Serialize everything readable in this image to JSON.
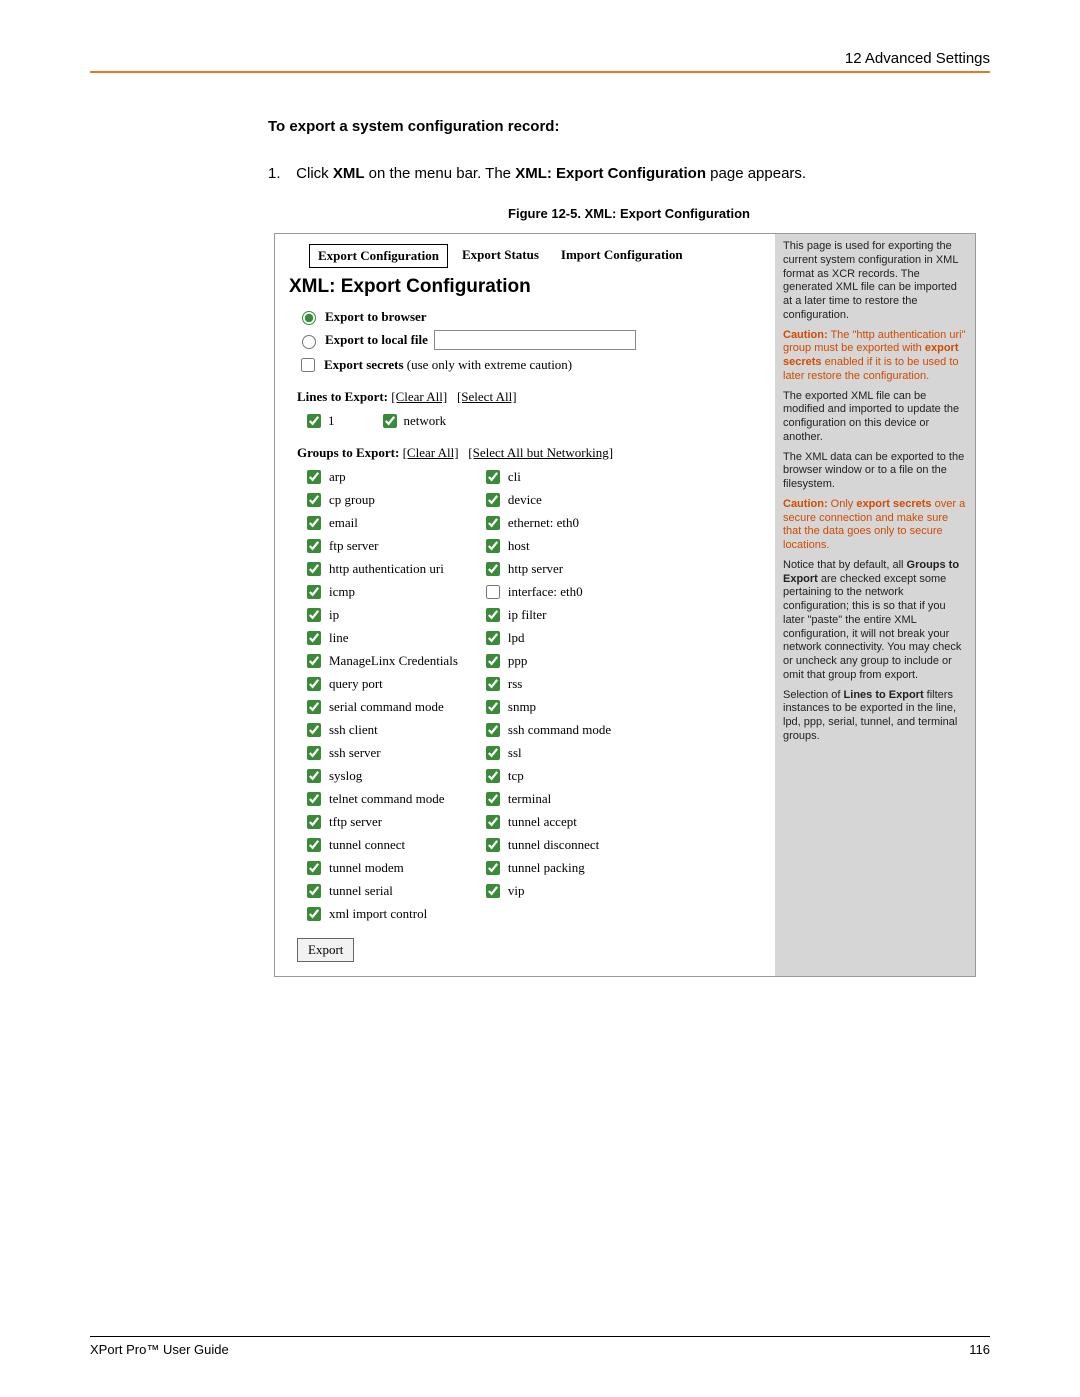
{
  "header": {
    "title": "12 Advanced Settings"
  },
  "body": {
    "heading": "To export a system configuration record:",
    "step_num": "1.",
    "step_a": "Click ",
    "step_b": "XML",
    "step_c": " on the menu bar. The ",
    "step_d": "XML: Export Configuration",
    "step_e": " page appears.",
    "fig_caption": "Figure 12-5. XML: Export Configuration"
  },
  "shot": {
    "tabs": {
      "t1": "Export Configuration",
      "t2": "Export Status",
      "t3": "Import Configuration"
    },
    "title": "XML: Export Configuration",
    "radio1": "Export to browser",
    "radio2": "Export to local file",
    "secrets_lbl": "Export secrets",
    "secrets_paren": " (use only with extreme caution)",
    "lines_label": "Lines to Export:  ",
    "clear_all": "[Clear All]",
    "select_all": "[Select All]",
    "line_items": {
      "a": "1",
      "b": "network"
    },
    "groups_label": "Groups to Export:  ",
    "sel_not_net": "[Select All but Networking]",
    "groups_left": [
      "arp",
      "cp group",
      "email",
      "ftp server",
      "http authentication uri",
      "icmp",
      "ip",
      "line",
      "ManageLinx Credentials",
      "query port",
      "serial command mode",
      "ssh client",
      "ssh server",
      "syslog",
      "telnet command mode",
      "tftp server",
      "tunnel connect",
      "tunnel modem",
      "tunnel serial",
      "xml import control"
    ],
    "groups_right": [
      {
        "label": "cli",
        "checked": true
      },
      {
        "label": "device",
        "checked": true
      },
      {
        "label": "ethernet: eth0",
        "checked": true
      },
      {
        "label": "host",
        "checked": true
      },
      {
        "label": "http server",
        "checked": true
      },
      {
        "label": "interface: eth0",
        "checked": false
      },
      {
        "label": "ip filter",
        "checked": true
      },
      {
        "label": "lpd",
        "checked": true
      },
      {
        "label": "ppp",
        "checked": true
      },
      {
        "label": "rss",
        "checked": true
      },
      {
        "label": "snmp",
        "checked": true
      },
      {
        "label": "ssh command mode",
        "checked": true
      },
      {
        "label": "ssl",
        "checked": true
      },
      {
        "label": "tcp",
        "checked": true
      },
      {
        "label": "terminal",
        "checked": true
      },
      {
        "label": "tunnel accept",
        "checked": true
      },
      {
        "label": "tunnel disconnect",
        "checked": true
      },
      {
        "label": "tunnel packing",
        "checked": true
      },
      {
        "label": "vip",
        "checked": true
      }
    ],
    "export_btn": "Export"
  },
  "side": {
    "p1": "This page is used for exporting the current system configuration in XML format as XCR records. The generated XML file can be imported at a later time to restore the configuration.",
    "c1a": "Caution:",
    "c1b": " The \"http authentication uri\" group must be exported with ",
    "c1c": "export secrets",
    "c1d": " enabled if it is to be used to later restore the configuration.",
    "p2": "The exported XML file can be modified and imported to update the configuration on this device or another.",
    "p3": "The XML data can be exported to the browser window or to a file on the filesystem.",
    "c2a": "Caution:",
    "c2b": " Only ",
    "c2c": "export secrets",
    "c2d": " over a secure connection and make sure that the data goes only to secure locations.",
    "p4a": "Notice that by default, all ",
    "p4b": "Groups to Export",
    "p4c": " are checked except some pertaining to the network configuration; this is so that if you later \"paste\" the entire XML configuration, it will not break your network connectivity. You may check or uncheck any group to include or omit that group from export.",
    "p5a": "Selection of ",
    "p5b": "Lines to Export",
    "p5c": " filters instances to be exported in the line, lpd, ppp, serial, tunnel, and terminal groups."
  },
  "footer": {
    "left": "XPort Pro™ User Guide",
    "right": "116"
  }
}
